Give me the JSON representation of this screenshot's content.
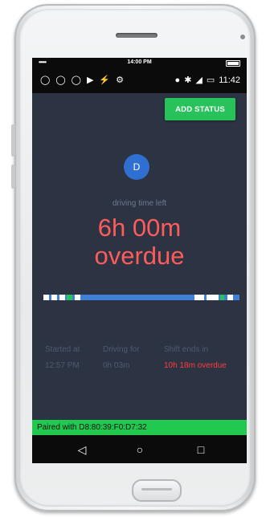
{
  "device": {
    "top_status": {
      "signal_dots": "•••••",
      "time": "14:00 PM"
    }
  },
  "statusbar": {
    "left_icons": [
      "bulb-icon",
      "bulb-icon",
      "bulb-icon",
      "video-icon",
      "plug-icon",
      "android-icon"
    ],
    "right_icons": [
      "location-icon",
      "bluetooth-icon",
      "cell-signal-icon",
      "sim-icon"
    ],
    "clock": "11:42"
  },
  "actions": {
    "add_status": "ADD STATUS"
  },
  "driver": {
    "initial": "D"
  },
  "drive": {
    "label": "driving time left",
    "time": "6h 00m",
    "status": "overdue"
  },
  "timeline": {
    "segments": [
      {
        "start": 0.0,
        "end": 0.03,
        "color": "#ffffff"
      },
      {
        "start": 0.04,
        "end": 0.07,
        "color": "#ffffff"
      },
      {
        "start": 0.08,
        "end": 0.11,
        "color": "#ffffff"
      },
      {
        "start": 0.12,
        "end": 0.15,
        "color": "#27c35a"
      },
      {
        "start": 0.16,
        "end": 0.19,
        "color": "#ffffff"
      },
      {
        "start": 0.77,
        "end": 0.82,
        "color": "#ffffff"
      },
      {
        "start": 0.83,
        "end": 0.89,
        "color": "#ffffff"
      },
      {
        "start": 0.9,
        "end": 0.92,
        "color": "#27c35a"
      },
      {
        "start": 0.94,
        "end": 0.97,
        "color": "#ffffff"
      }
    ]
  },
  "info": {
    "started_label": "Started at",
    "started_value": "12:57 PM",
    "driving_label": "Driving for",
    "driving_value": "0h 03m",
    "shift_label": "Shift ends in",
    "shift_value": "10h 18m overdue"
  },
  "paired": {
    "text": "Paired with D8:80:39:F0:D7:32"
  },
  "nav": {
    "back": "◁",
    "home": "○",
    "recent": "□"
  }
}
